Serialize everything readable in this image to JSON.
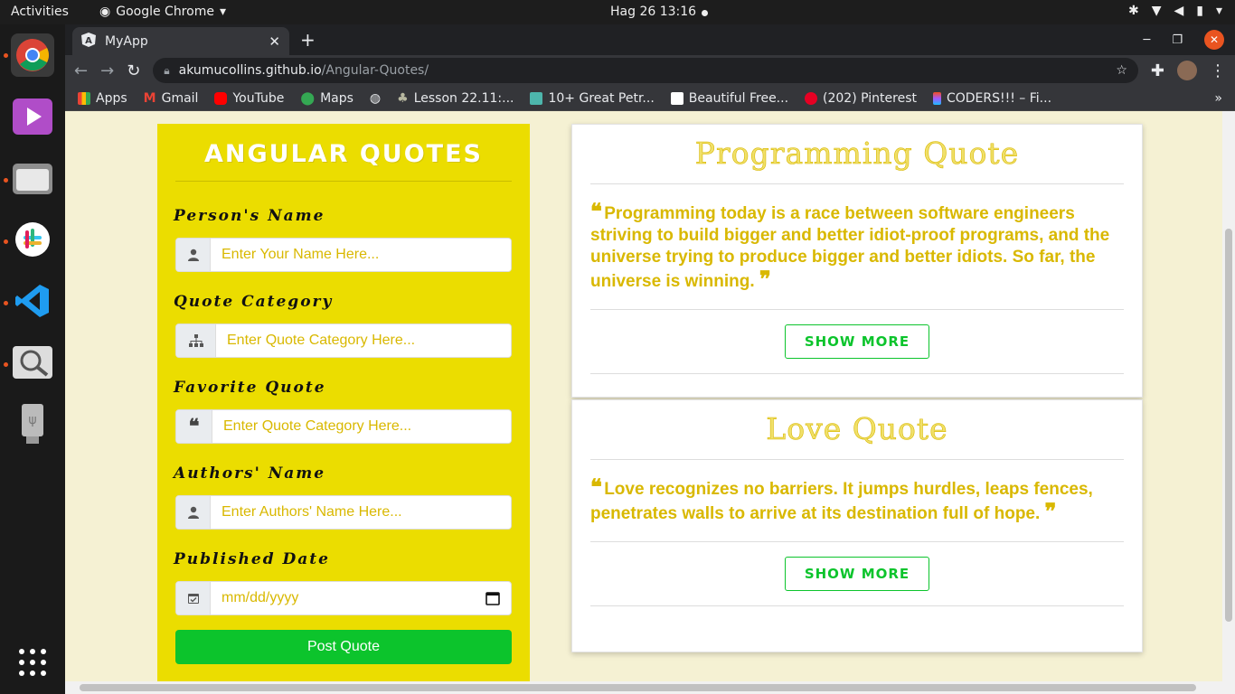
{
  "system": {
    "activities": "Activities",
    "app_name": "Google Chrome",
    "clock": "Hag 26  13:16"
  },
  "browser": {
    "tab_title": "MyApp",
    "url_host": "akumucollins.github.io",
    "url_path": "/Angular-Quotes/",
    "bookmarks": [
      {
        "label": "Apps"
      },
      {
        "label": "Gmail"
      },
      {
        "label": "YouTube"
      },
      {
        "label": "Maps"
      },
      {
        "label": "Lesson 22.11:..."
      },
      {
        "label": "10+ Great Petr..."
      },
      {
        "label": "Beautiful Free..."
      },
      {
        "label": "(202) Pinterest"
      },
      {
        "label": "CODERS!!! – Fi..."
      }
    ]
  },
  "form": {
    "title": "ANGULAR QUOTES",
    "name_label": "Person's Name",
    "name_placeholder": "Enter Your Name Here...",
    "category_label": "Quote Category",
    "category_placeholder": "Enter Quote Category Here...",
    "quote_label": "Favorite Quote",
    "quote_placeholder": "Enter Quote Category Here...",
    "author_label": "Authors' Name",
    "author_placeholder": "Enter Authors' Name Here...",
    "date_label": "Published Date",
    "date_placeholder": "mm/dd/yyyy",
    "submit_label": "Post Quote"
  },
  "quotes": [
    {
      "title": "Programming Quote",
      "text": "Programming today is a race between software engineers striving to build bigger and better idiot-proof programs, and the universe trying to produce bigger and better idiots. So far, the universe is winning.",
      "button": "SHOW MORE"
    },
    {
      "title": "Love Quote",
      "text": "Love recognizes no barriers. It jumps hurdles, leaps fences, penetrates walls to arrive at its destination full of hope.",
      "button": "SHOW MORE"
    }
  ],
  "colors": {
    "form_bg": "#ebdd00",
    "accent_gold": "#d9b800",
    "button_green": "#0cc42c",
    "page_bg": "#f5f1d3"
  }
}
